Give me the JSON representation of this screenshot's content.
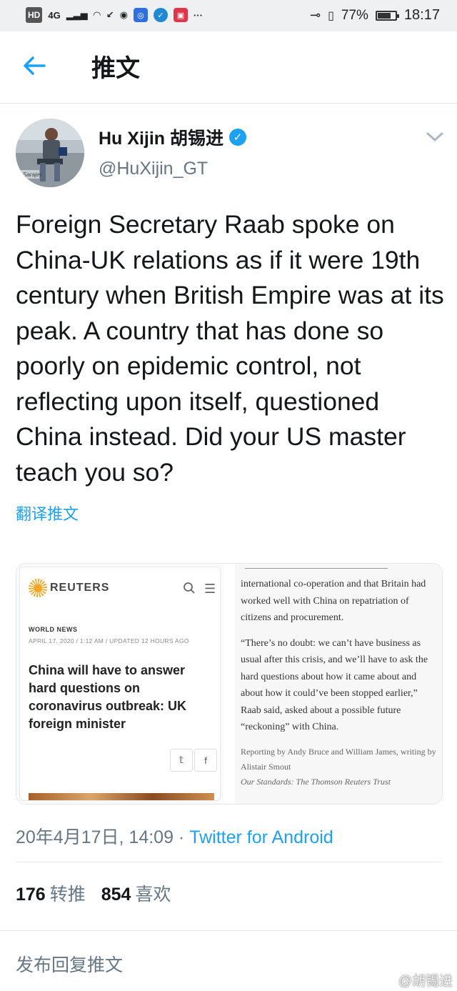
{
  "status_bar": {
    "hd": "HD",
    "network": "4G",
    "battery_percent": "77%",
    "battery_level": 0.77,
    "time": "18:17",
    "more": "···"
  },
  "header": {
    "title": "推文"
  },
  "tweet": {
    "author_name": "Hu Xijin 胡锡进",
    "handle": "@HuXijin_GT",
    "avatar_caption": "Sarajev",
    "text": "Foreign Secretary Raab spoke on China-UK relations as if it were 19th century when British Empire was at its peak. A country that has done so poorly on epidemic control, not reflecting upon itself, questioned China instead. Did your US master teach you so?",
    "translate_label": "翻译推文",
    "timestamp": "20年4月17日, 14:09",
    "separator": " · ",
    "source": "Twitter for Android",
    "retweets_count": "176",
    "retweets_label": "转推",
    "likes_count": "854",
    "likes_label": "喜欢"
  },
  "media": {
    "left": {
      "brand": "REUTERS",
      "category": "WORLD NEWS",
      "date": "APRIL 17, 2020 / 1:12 AM / UPDATED 12 HOURS AGO",
      "headline": "China will have to answer hard questions on coronavirus outbreak: UK foreign minister"
    },
    "right": {
      "para1": "international co-operation and that Britain had worked well with China on repatriation of citizens and procurement.",
      "para2": "“There’s no doubt: we can’t have business as usual after this crisis, and we’ll have to ask the hard questions about how it came about and about how it could’ve been stopped earlier,” Raab said, asked about a possible future “reckoning” with China.",
      "credit": "Reporting by Andy Bruce and William James, writing by Alistair Smout",
      "standards": "Our Standards:  The Thomson Reuters Trust"
    }
  },
  "reply": {
    "placeholder": "发布回复推文"
  },
  "watermark": "@胡锡进",
  "colors": {
    "accent": "#1da1f2",
    "secondary_text": "#657786",
    "primary_text": "#14171a"
  }
}
